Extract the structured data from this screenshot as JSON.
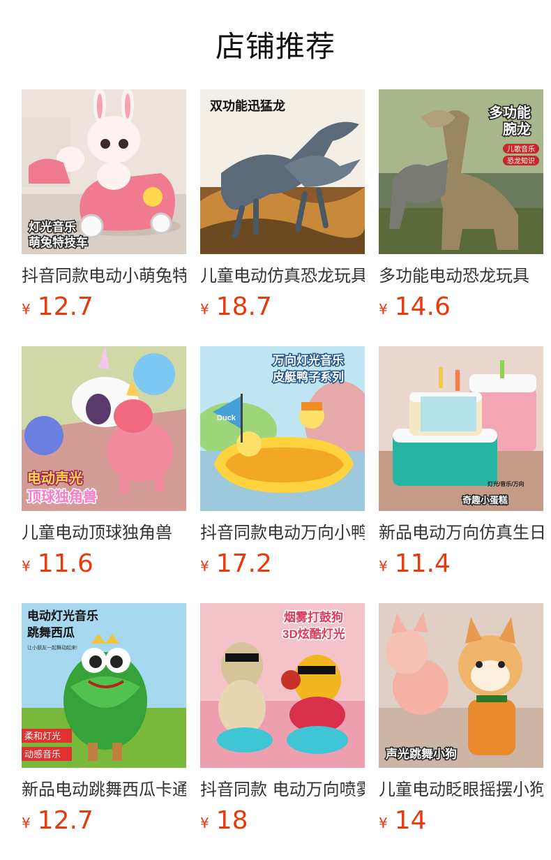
{
  "header": {
    "title": "店铺推荐"
  },
  "currency_symbol": "¥",
  "colors": {
    "price": "#e8390f",
    "title_text": "#333333"
  },
  "products": [
    {
      "title": "抖音同款电动小萌兔特技车",
      "price": "12.7",
      "image_caption": [
        "灯光音乐",
        "萌兔特技车"
      ],
      "image_icon": "bunny-scooter-icon"
    },
    {
      "title": "儿童电动仿真恐龙玩具",
      "price": "18.7",
      "image_caption": [
        "双功能迅猛龙"
      ],
      "image_icon": "raptor-dinosaur-icon"
    },
    {
      "title": "多功能电动恐龙玩具",
      "price": "14.6",
      "image_caption": [
        "多功能",
        "腕龙",
        "儿歌音乐",
        "恐龙知识"
      ],
      "image_icon": "brachiosaurus-icon"
    },
    {
      "title": "儿童电动顶球独角兽",
      "price": "11.6",
      "image_caption": [
        "电动声光",
        "顶球独角兽"
      ],
      "image_icon": "unicorn-ball-icon"
    },
    {
      "title": "抖音同款电动万向小鸭",
      "price": "17.2",
      "image_caption": [
        "万向灯光音乐",
        "皮艇鸭子系列",
        "Duck"
      ],
      "image_icon": "duck-boat-icon"
    },
    {
      "title": "新品电动万向仿真生日蛋糕",
      "price": "11.4",
      "image_caption": [
        "灯光/音乐/万向",
        "奇趣小蛋糕"
      ],
      "image_icon": "birthday-cake-icon"
    },
    {
      "title": "新品电动跳舞西瓜卡通",
      "price": "12.7",
      "image_caption": [
        "电动灯光音乐",
        "跳舞西瓜",
        "让小朋友一起舞动起来!",
        "柔和灯光",
        "动感音乐"
      ],
      "image_icon": "watermelon-dancer-icon"
    },
    {
      "title": "抖音同款 电动万向喷雾打鼓狗",
      "price": "18",
      "image_caption": [
        "烟雾打鼓狗",
        "3D炫酷灯光"
      ],
      "image_icon": "drumming-dog-icon"
    },
    {
      "title": "儿童电动眨眼摇摆小狗",
      "price": "14",
      "image_caption": [
        "声光跳舞小狗"
      ],
      "image_icon": "shiba-dog-icon"
    }
  ]
}
